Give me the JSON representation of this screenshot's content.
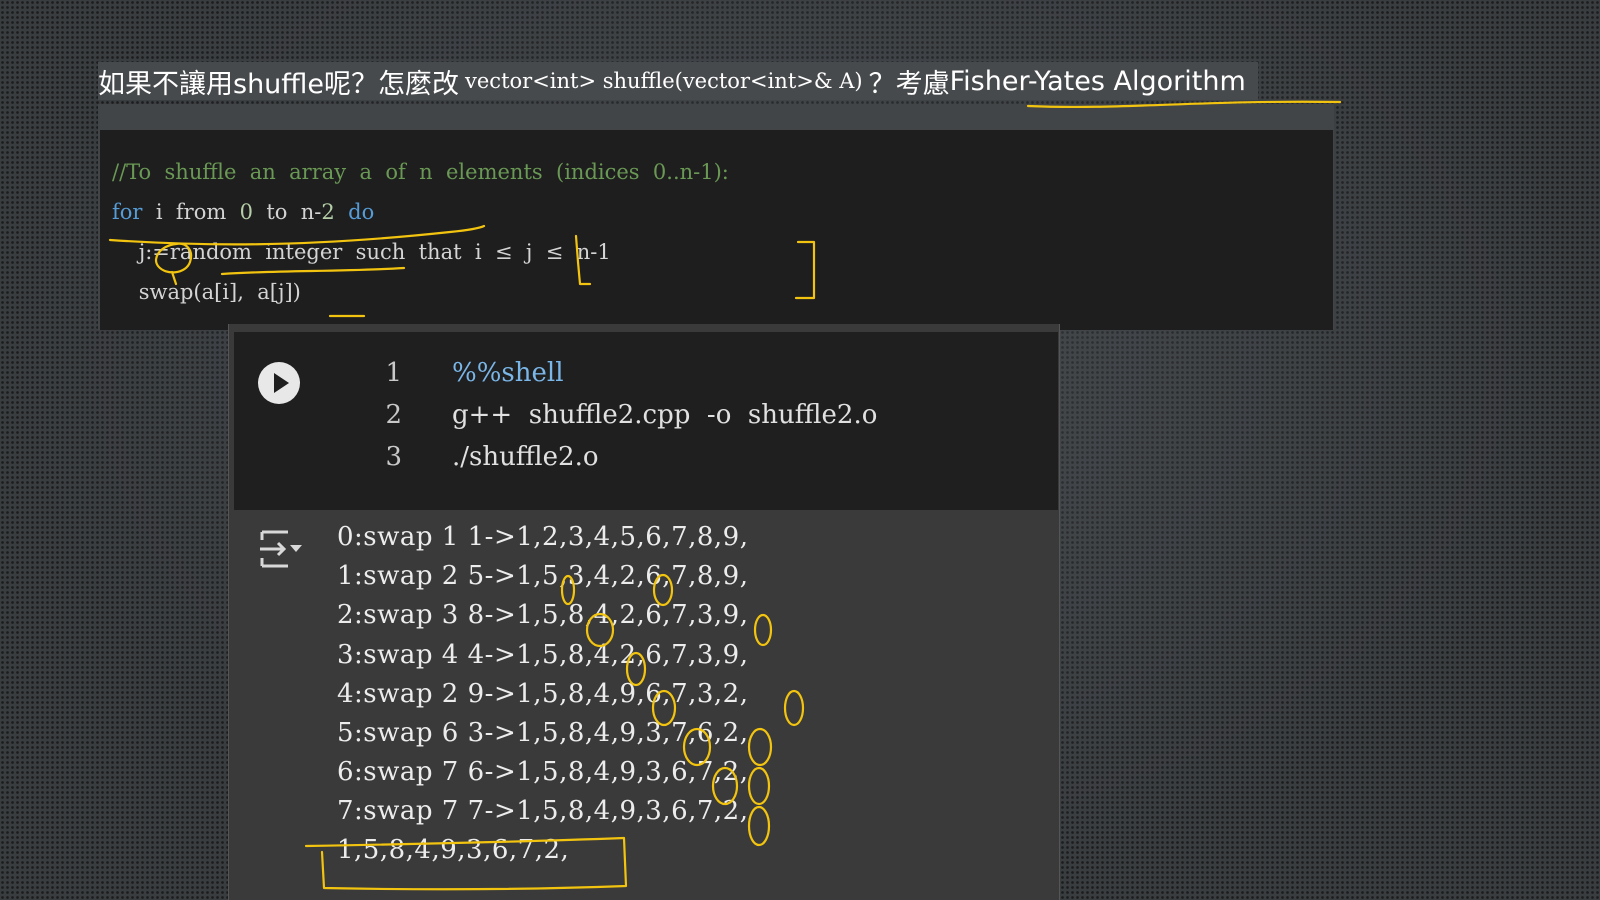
{
  "title": {
    "prefix": "如果不讓用shuffle呢？怎麼改",
    "code": "vector<int> shuffle(vector<int>& A)",
    "middle": "？考慮",
    "highlight": "Fisher-Yates Algorithm"
  },
  "pseudocode": {
    "lines": [
      "//To  shuffle  an  array  a  of  n  elements  (indices  0..n-1):",
      "for  i  from  0  to  n-2  do",
      "    j:=random  integer  such  that  i  ≤  j  ≤  n-1",
      "    swap(a[i],  a[j])"
    ]
  },
  "cell": {
    "line_numbers": [
      "1",
      "2",
      "3"
    ],
    "code": [
      "%%shell",
      "g++  shuffle2.cpp  -o  shuffle2.o",
      "./shuffle2.o"
    ],
    "output": [
      "0:swap 1 1->1,2,3,4,5,6,7,8,9,",
      "1:swap 2 5->1,5,3,4,2,6,7,8,9,",
      "2:swap 3 8->1,5,8,4,2,6,7,3,9,",
      "3:swap 4 4->1,5,8,4,2,6,7,3,9,",
      "4:swap 2 9->1,5,8,4,9,6,7,3,2,",
      "5:swap 6 3->1,5,8,4,9,3,7,6,2,",
      "6:swap 7 6->1,5,8,4,9,3,6,7,2,",
      "7:swap 7 7->1,5,8,4,9,3,6,7,2,",
      "1,5,8,4,9,3,6,7,2,"
    ]
  },
  "icons": {
    "run": "play-icon",
    "output": "output-toggle-icon"
  },
  "colors": {
    "annotation": "#f2c40f",
    "keyword": "#569cd6",
    "comment": "#6a9955",
    "magic": "#7ab6e8"
  }
}
